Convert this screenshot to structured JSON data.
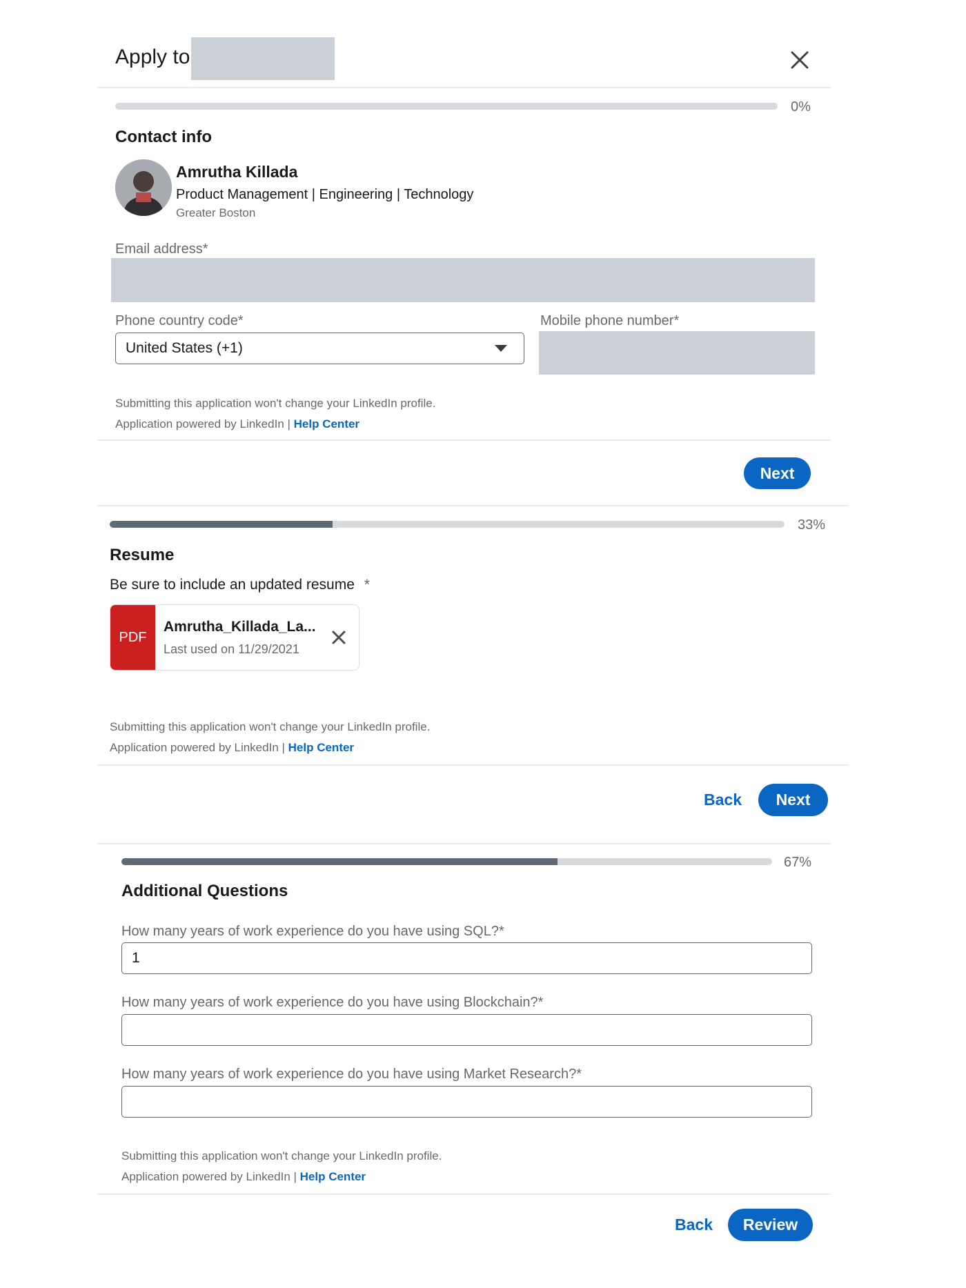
{
  "header": {
    "title": "Apply to",
    "close_icon": "close-icon"
  },
  "step1": {
    "progress_label": "0%",
    "progress": 0,
    "section_title": "Contact info",
    "profile": {
      "name": "Amrutha Killada",
      "headline": "Product Management | Engineering | Technology",
      "location": "Greater Boston"
    },
    "email_label": "Email address*",
    "phone_code_label": "Phone country code*",
    "phone_code_value": "United States (+1)",
    "mobile_label": "Mobile phone number*",
    "footer_line1": "Submitting this application won't change your LinkedIn profile.",
    "footer_line2": "Application powered by LinkedIn | ",
    "help_center": "Help Center",
    "next_label": "Next"
  },
  "step2": {
    "progress_label": "33%",
    "progress": 0.33,
    "section_title": "Resume",
    "prompt": "Be sure to include an updated resume",
    "required_mark": "*",
    "file_badge": "PDF",
    "file_name": "Amrutha_Killada_La...",
    "file_meta": "Last used on 11/29/2021",
    "footer_line1": "Submitting this application won't change your LinkedIn profile.",
    "footer_line2": "Application powered by LinkedIn | ",
    "help_center": "Help Center",
    "back_label": "Back",
    "next_label": "Next"
  },
  "step3": {
    "progress_label": "67%",
    "progress": 0.67,
    "section_title": "Additional Questions",
    "q1_label": "How many years of work experience do you have using SQL?*",
    "q1_value": "1",
    "q2_label": "How many years of work experience do you have using Blockchain?*",
    "q2_value": "",
    "q3_label": "How many years of work experience do you have using Market Research?*",
    "q3_value": "",
    "footer_line1": "Submitting this application won't change your LinkedIn profile.",
    "footer_line2": "Application powered by LinkedIn | ",
    "help_center": "Help Center",
    "back_label": "Back",
    "review_label": "Review"
  },
  "colors": {
    "primary": "#0a66c2",
    "pdf_badge": "#cc1f1f",
    "progress_fill": "#5e6b77",
    "redaction": "#cbd0d7"
  }
}
